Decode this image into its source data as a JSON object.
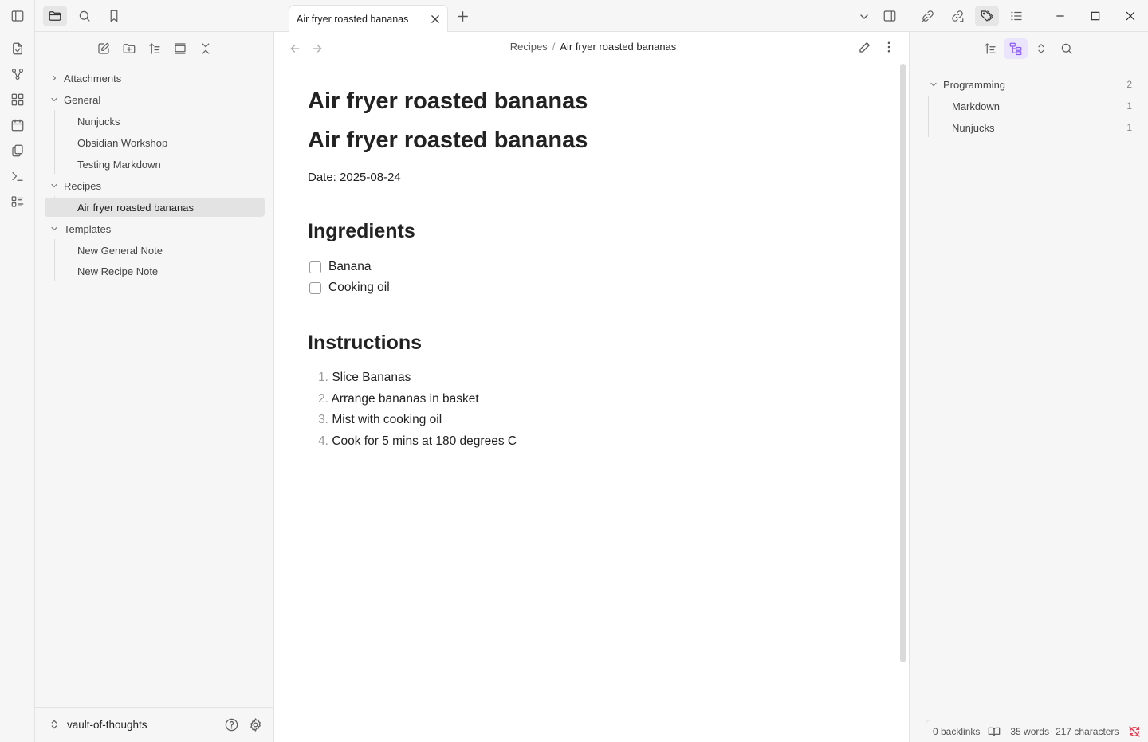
{
  "colors": {
    "accent": "#8a5cf5",
    "sync_error": "#e93147",
    "selected_bg": "#e3e3e3"
  },
  "ribbon": {
    "icons": [
      "open-quick-switcher-icon",
      "graph-view-icon",
      "canvas-icon",
      "daily-note-icon",
      "templates-icon",
      "command-palette-icon",
      "bases-icon"
    ]
  },
  "left_sidebar": {
    "top_tabs": [
      "files-tab",
      "search-tab",
      "bookmarks-tab"
    ],
    "toolbar": [
      "new-note",
      "new-folder",
      "change-sort-order",
      "auto-reveal-file",
      "collapse-all"
    ],
    "tree": {
      "attachments": "Attachments",
      "general": "General",
      "general_children": [
        "Nunjucks",
        "Obsidian Workshop",
        "Testing Markdown"
      ],
      "recipes": "Recipes",
      "recipes_children": [
        "Air fryer roasted bananas"
      ],
      "templates": "Templates",
      "templates_children": [
        "New General Note",
        "New Recipe Note"
      ]
    },
    "vault_name": "vault-of-thoughts"
  },
  "tab": {
    "title": "Air fryer roasted bananas"
  },
  "breadcrumb": {
    "folder": "Recipes",
    "separator": "/",
    "note": "Air fryer roasted bananas"
  },
  "note": {
    "title": "Air fryer roasted bananas",
    "h1": "Air fryer roasted bananas",
    "date_line": "Date: 2025-08-24",
    "ingredients_heading": "Ingredients",
    "ingredients": [
      "Banana",
      "Cooking oil"
    ],
    "instructions_heading": "Instructions",
    "instructions": [
      "Slice Bananas",
      "Arrange bananas in basket",
      "Mist with cooking oil",
      "Cook for 5 mins at 180 degrees C"
    ],
    "instruction_numbers": [
      "1.",
      "2.",
      "3.",
      "4."
    ]
  },
  "right_sidebar": {
    "tags": [
      {
        "name": "Programming",
        "count": "2"
      },
      {
        "name": "Markdown",
        "count": "1"
      },
      {
        "name": "Nunjucks",
        "count": "1"
      }
    ]
  },
  "status_bar": {
    "backlinks": "0 backlinks",
    "words": "35 words",
    "characters": "217 characters"
  }
}
